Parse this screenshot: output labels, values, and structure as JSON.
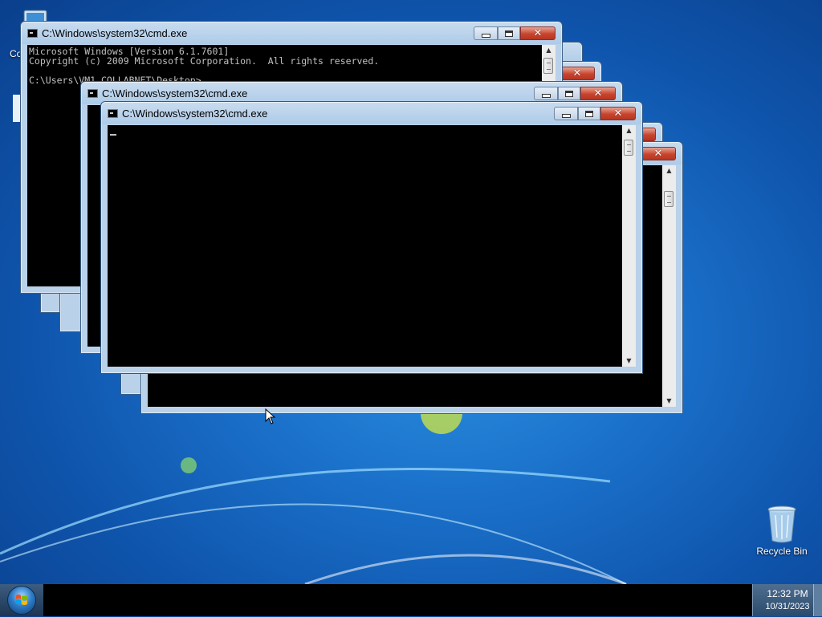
{
  "desktop": {
    "icons": [
      {
        "label": "Co",
        "icon": "computer-icon"
      },
      {
        "label": "Recycle Bin",
        "icon": "recycle-bin-icon"
      }
    ]
  },
  "windows": [
    {
      "title": "C:\\Windows\\system32\\cmd.exe",
      "lines": [
        "Microsoft Windows [Version 6.1.7601]",
        "Copyright (c) 2009 Microsoft Corporation.  All rights reserved.",
        "",
        "C:\\Users\\VM1_COLLABNET\\Desktop>"
      ]
    },
    {
      "title": "C:\\Windows\\system32\\cmd.exe",
      "lines": []
    },
    {
      "title": "C:\\Windows\\system32\\cmd.exe",
      "lines": []
    }
  ],
  "taskbar": {
    "start_icon": "windows-start-orb",
    "clock": {
      "time": "12:32 PM",
      "date": "10/31/2023"
    }
  },
  "colors": {
    "console_bg": "#000000",
    "console_fg": "#c0c0c0",
    "close_button": "#c7452f"
  }
}
